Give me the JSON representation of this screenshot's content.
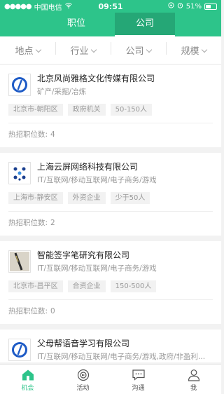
{
  "status_bar": {
    "carrier": "中国电信",
    "time": "09:51",
    "battery": "51%"
  },
  "tabs": [
    {
      "label": "职位",
      "active": false
    },
    {
      "label": "公司",
      "active": true
    }
  ],
  "filters": [
    {
      "label": "地点"
    },
    {
      "label": "行业"
    },
    {
      "label": "公司"
    },
    {
      "label": "规模"
    }
  ],
  "hot_label": "热招职位数:",
  "companies": [
    {
      "name": "北京风尚雅格文化传媒有限公司",
      "industry": "矿产/采掘/冶炼",
      "tags": [
        "北京市-朝阳区",
        "政府机关",
        "50-150人"
      ],
      "hot_count": "4",
      "logo": "blue-circle-logo"
    },
    {
      "name": "上海云屏网络科技有限公司",
      "industry": "IT/互联网/移动互联网/电子商务/游戏",
      "tags": [
        "上海市-静安区",
        "外资企业",
        "少于50人"
      ],
      "hot_count": "2",
      "logo": "blue-cross-logo"
    },
    {
      "name": "智能签字笔研究有限公司",
      "industry": "IT/互联网/移动互联网/电子商务/游戏",
      "tags": [
        "北京市-昌平区",
        "合资企业",
        "150-500人"
      ],
      "hot_count": "0",
      "logo": "pen-photo-logo"
    },
    {
      "name": "父母帮语音学习有限公司",
      "industry": "IT/互联网/移动互联网/电子商务/游戏,政府/非盈利...",
      "tags": [],
      "hot_count": "",
      "logo": "blue-circle-logo"
    }
  ],
  "tabbar": [
    {
      "label": "机会",
      "icon": "home-icon",
      "active": true
    },
    {
      "label": "活动",
      "icon": "activity-icon",
      "active": false
    },
    {
      "label": "沟通",
      "icon": "chat-icon",
      "active": false
    },
    {
      "label": "我",
      "icon": "profile-icon",
      "active": false
    }
  ],
  "colors": {
    "accent": "#2dc48a",
    "accent_dark": "#25a776"
  }
}
